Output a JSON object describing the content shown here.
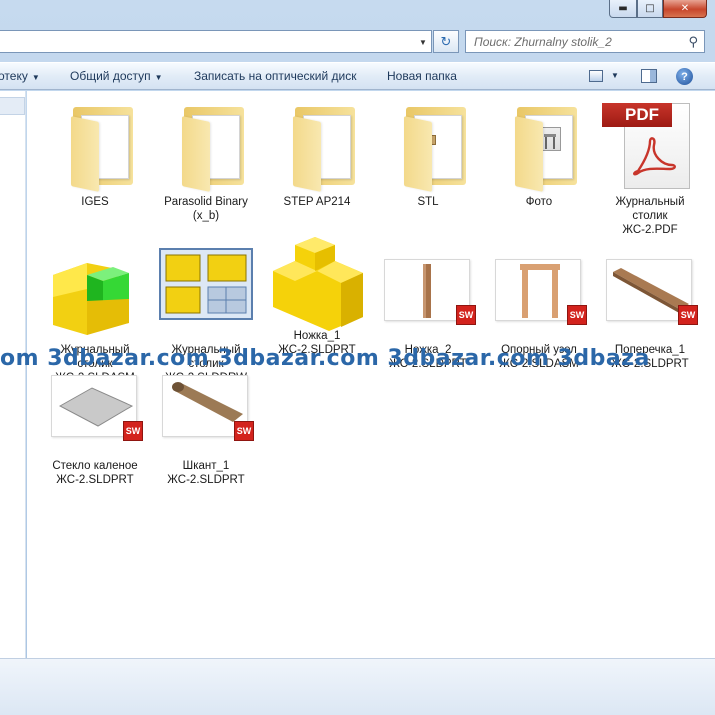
{
  "window": {
    "minimize": "▬",
    "maximize": "□",
    "close": "✕"
  },
  "address": {
    "refresh_glyph": "↻"
  },
  "search": {
    "placeholder": "Поиск: Zhurnalny stolik_2"
  },
  "toolbar": {
    "library_label": "отеку",
    "share_label": "Общий доступ",
    "burn_label": "Записать на оптический диск",
    "new_folder_label": "Новая папка",
    "help": "?"
  },
  "files": [
    {
      "name": "IGES",
      "type": "folder"
    },
    {
      "name": "Parasolid Binary\n(x_b)",
      "type": "folder"
    },
    {
      "name": "STEP AP214",
      "type": "folder"
    },
    {
      "name": "STL",
      "type": "folder"
    },
    {
      "name": "Фото",
      "type": "folder"
    },
    {
      "name": "Журнальный\nстолик\nЖС-2.PDF",
      "type": "pdf",
      "badge": "PDF"
    },
    {
      "name": "Журнальный\nстолик\nЖС-2.SLDASM",
      "type": "sldasm"
    },
    {
      "name": "Журнальный\nстолик\nЖС-2.SLDDRW",
      "type": "slddrw"
    },
    {
      "name": "Ножка_1\nЖС-2.SLDPRT",
      "type": "sldprt"
    },
    {
      "name": "Ножка_2\nЖС-2.SLDPRT",
      "type": "sldprt",
      "badge": "SW"
    },
    {
      "name": "Опорный узел\nЖС-2.SLDASM",
      "type": "sldasm",
      "badge": "SW"
    },
    {
      "name": "Поперечка_1\nЖС-2.SLDPRT",
      "type": "sldprt",
      "badge": "SW"
    },
    {
      "name": "Стекло каленое\nЖС-2.SLDPRT",
      "type": "sldprt",
      "badge": "SW"
    },
    {
      "name": "Шкант_1\nЖС-2.SLDPRT",
      "type": "sldprt",
      "badge": "SW"
    }
  ],
  "watermark": "om  3dbazar.com  3dbazar.com  3dbazar.com  3dbaza",
  "colors": {
    "folder": "#f3d98a",
    "sw_badge": "#d3231d",
    "pdf_red": "#c8352b",
    "watermark": "#2b67a8"
  }
}
